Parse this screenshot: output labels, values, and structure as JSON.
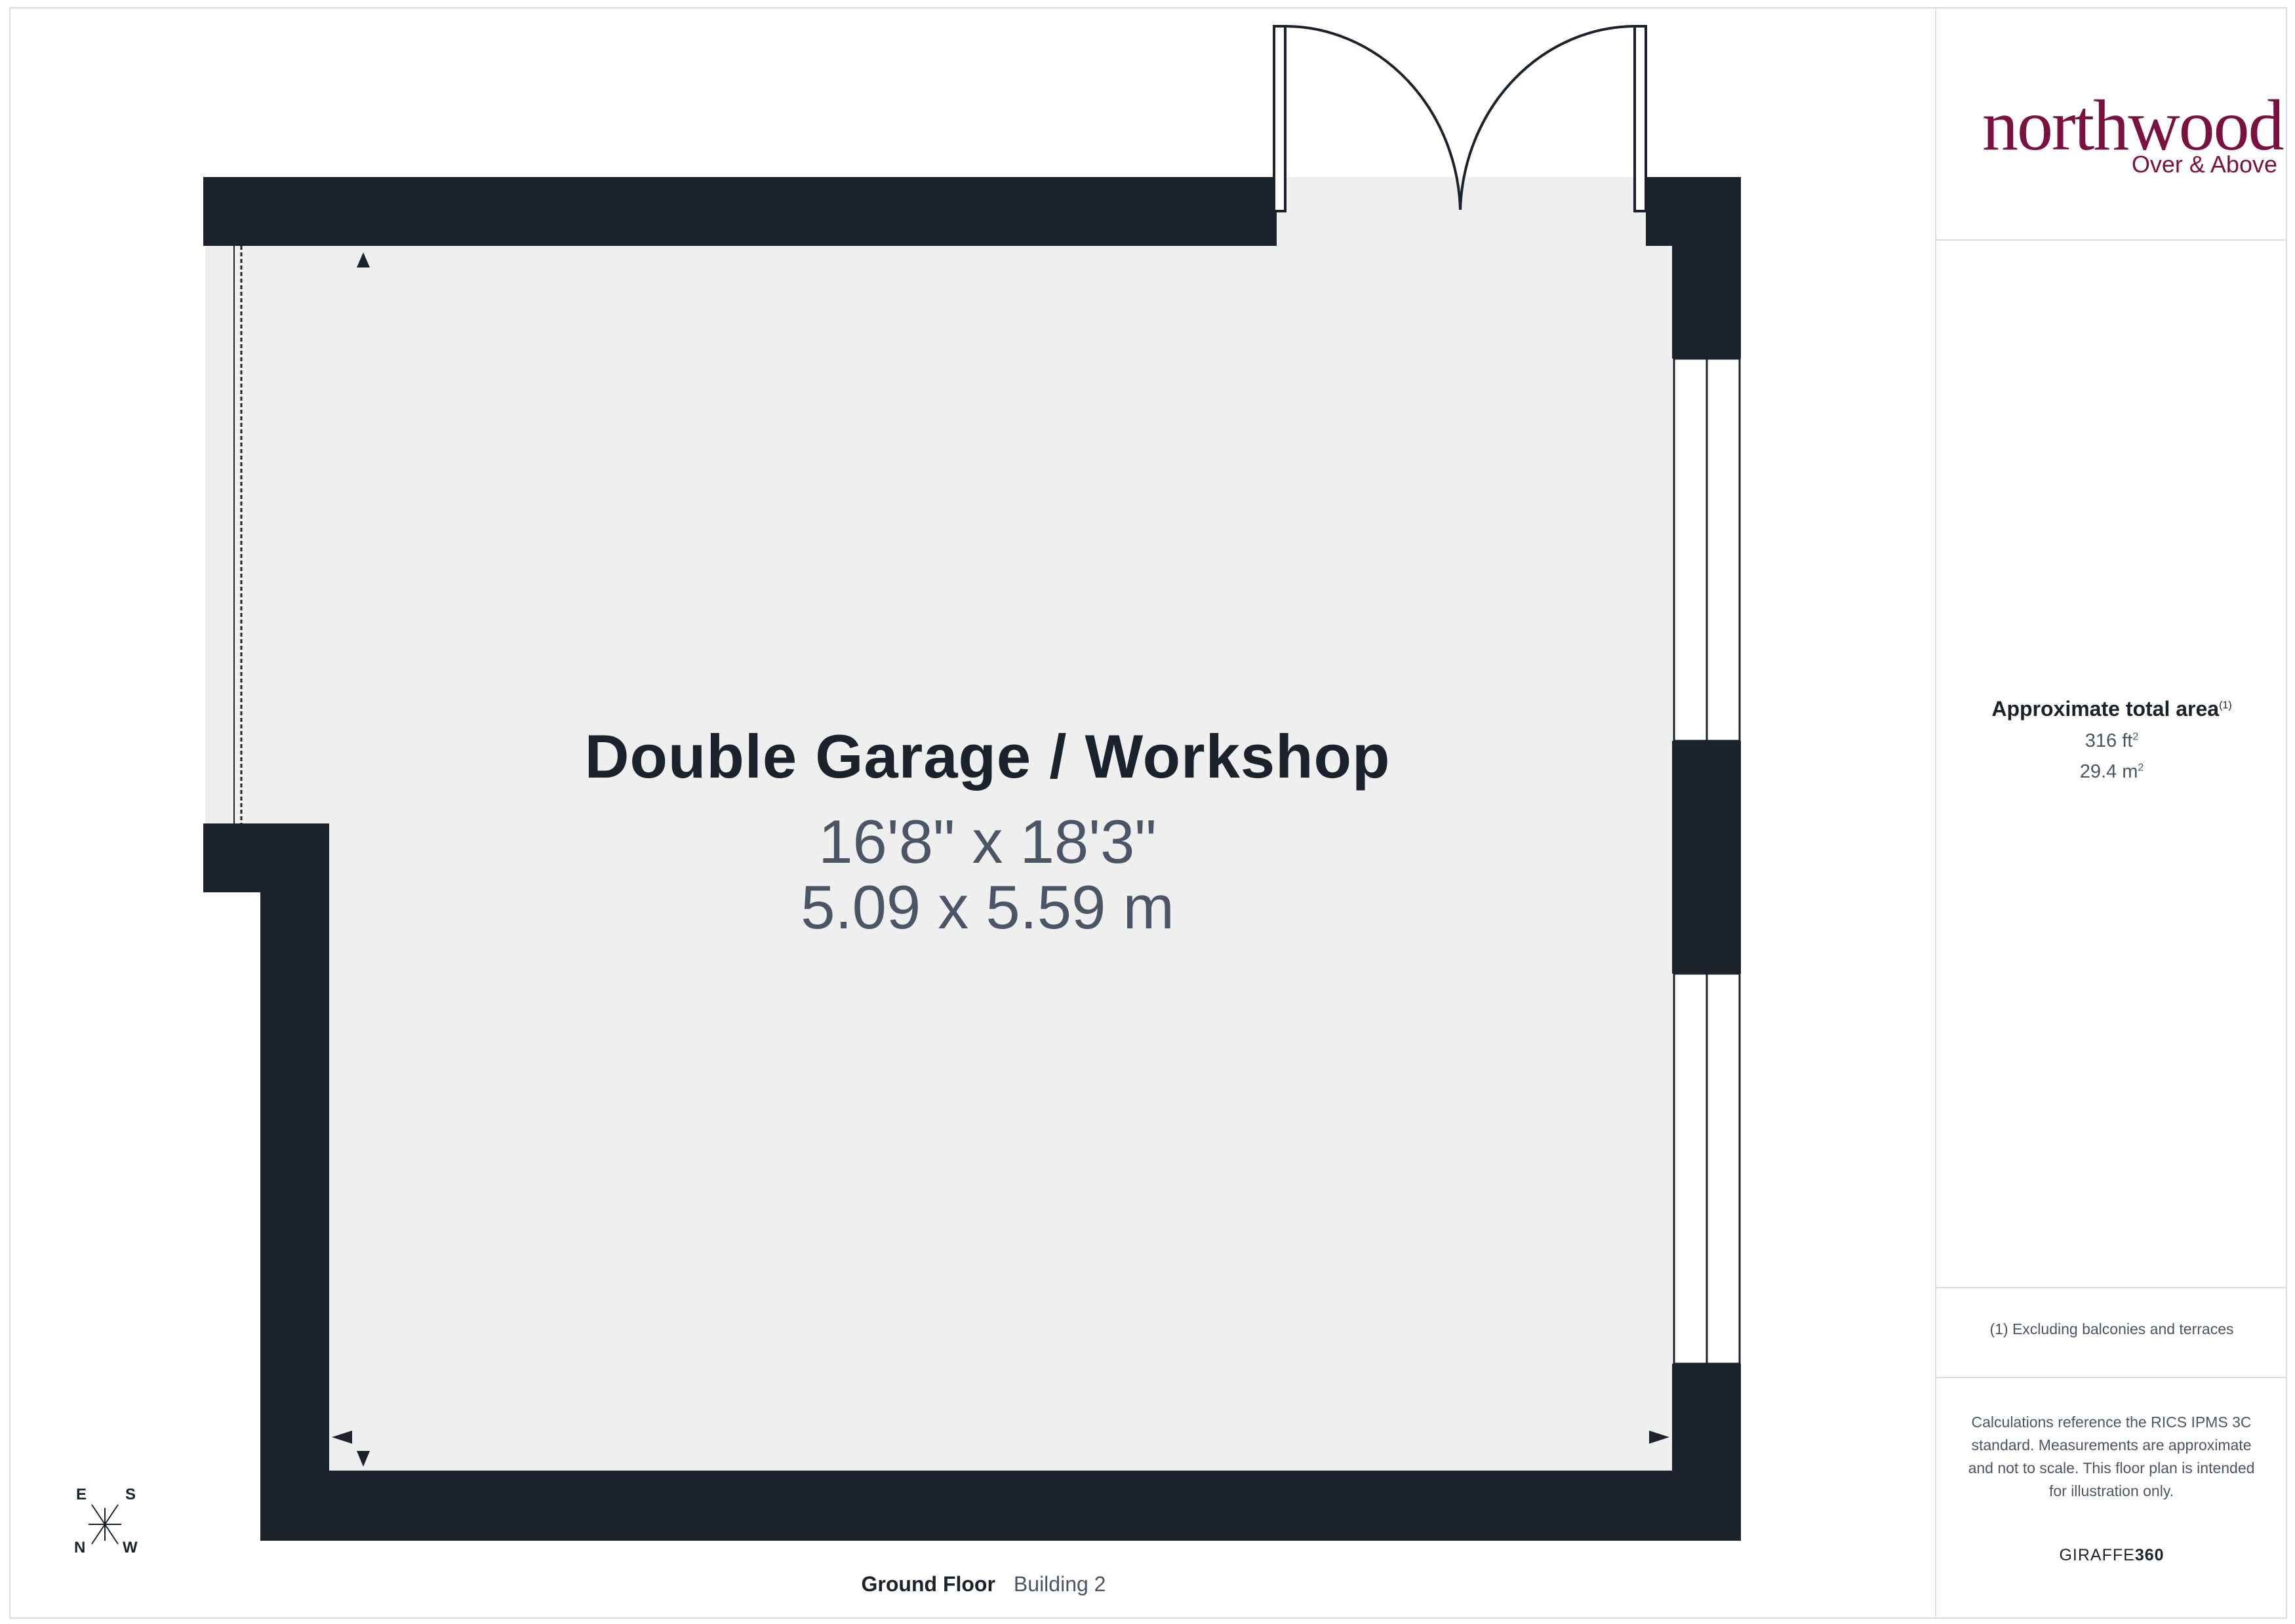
{
  "room": {
    "name": "Double Garage / Workshop",
    "dim_imperial": "16'8\" x 18'3\"",
    "dim_metric": "5.09 x 5.59 m"
  },
  "floor": {
    "label": "Ground Floor",
    "building": "Building 2"
  },
  "brand": {
    "name": "northwood",
    "tagline": "Over & Above",
    "color_primary": "#7a1140",
    "color_accent": "#f5d100"
  },
  "area": {
    "title": "Approximate total area",
    "title_note": "(1)",
    "ft2": "316 ft",
    "ft2_unit_sup": "2",
    "m2": "29.4 m",
    "m2_unit_sup": "2"
  },
  "footnote": "(1) Excluding balconies and terraces",
  "disclaimer": "Calculations reference the RICS IPMS 3C standard. Measurements are approximate and not to scale. This floor plan is intended for illustration only.",
  "credit": {
    "prefix": "GIRAFFE",
    "suffix": "360"
  },
  "compass": {
    "e": "E",
    "s": "S",
    "n": "N",
    "w": "W"
  },
  "colors": {
    "wall": "#1b222c",
    "floor": "#efefef",
    "text_muted": "#4b5565"
  }
}
